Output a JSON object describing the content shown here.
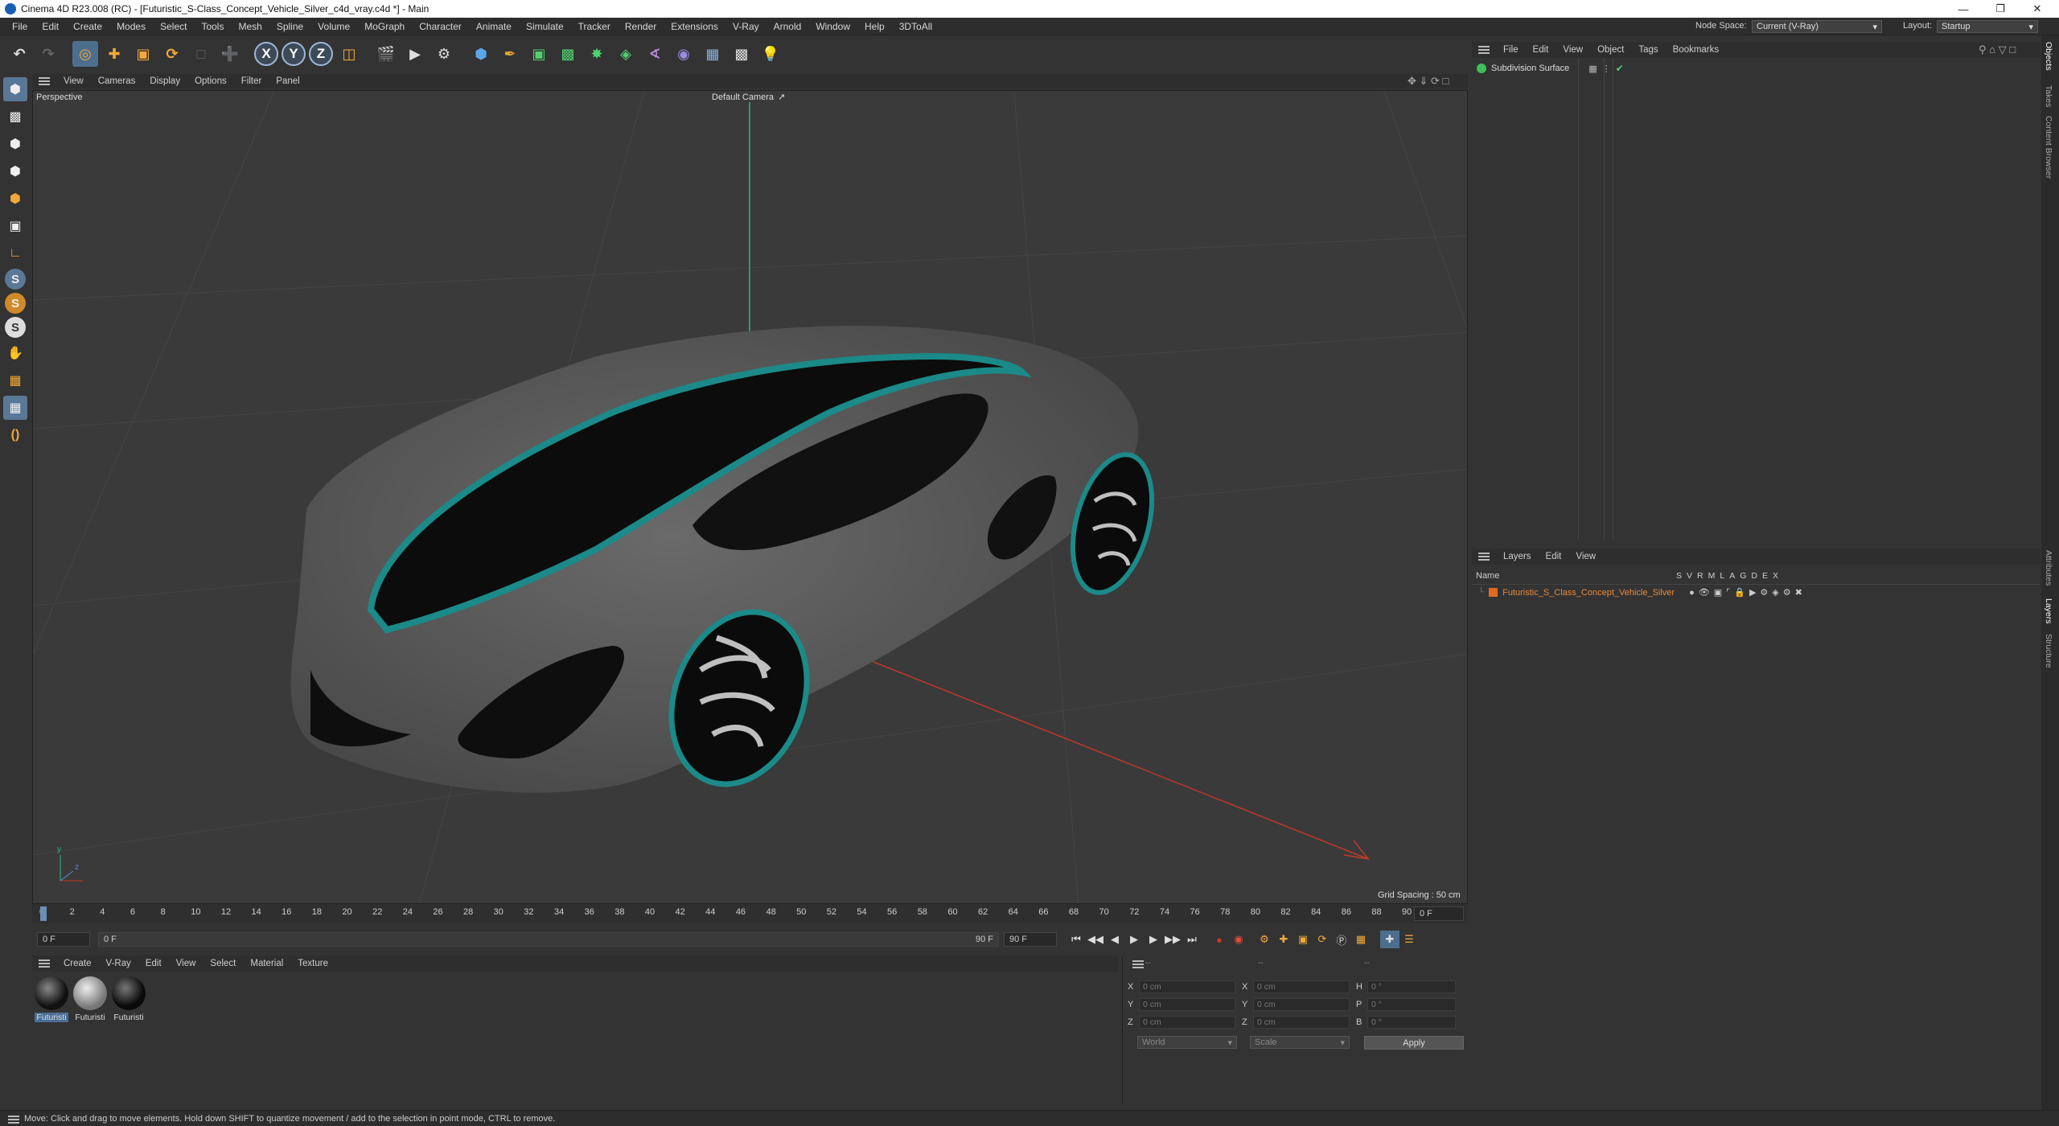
{
  "window": {
    "title": "Cinema 4D R23.008 (RC) - [Futuristic_S-Class_Concept_Vehicle_Silver_c4d_vray.c4d *] - Main"
  },
  "menu": [
    "File",
    "Edit",
    "Create",
    "Modes",
    "Select",
    "Tools",
    "Mesh",
    "Spline",
    "Volume",
    "MoGraph",
    "Character",
    "Animate",
    "Simulate",
    "Tracker",
    "Render",
    "Extensions",
    "V-Ray",
    "Arnold",
    "Window",
    "Help",
    "3DToAll"
  ],
  "header_right": {
    "node_space_label": "Node Space:",
    "node_space_value": "Current (V-Ray)",
    "layout_label": "Layout:",
    "layout_value": "Startup"
  },
  "toolbar": {
    "axes": [
      "X",
      "Y",
      "Z"
    ]
  },
  "viewport": {
    "menu": [
      "View",
      "Cameras",
      "Display",
      "Options",
      "Filter",
      "Panel"
    ],
    "name": "Perspective",
    "camera": "Default Camera",
    "grid_spacing": "Grid Spacing : 50 cm",
    "colors": {
      "body": "#5b5b5b",
      "glass": "#0c0c0c",
      "accent": "#1b8a88"
    }
  },
  "timeline": {
    "ticks": [
      "0",
      "2",
      "4",
      "6",
      "8",
      "10",
      "12",
      "14",
      "16",
      "18",
      "20",
      "22",
      "24",
      "26",
      "28",
      "30",
      "32",
      "34",
      "36",
      "38",
      "40",
      "42",
      "44",
      "46",
      "48",
      "50",
      "52",
      "54",
      "56",
      "58",
      "60",
      "62",
      "64",
      "66",
      "68",
      "70",
      "72",
      "74",
      "76",
      "78",
      "80",
      "82",
      "84",
      "86",
      "88",
      "90"
    ],
    "current_frame": "0 F"
  },
  "transport": {
    "start": "0 F",
    "preview_start": "0 F",
    "preview_end": "90 F",
    "end": "90 F"
  },
  "materials": {
    "menu": [
      "Create",
      "V-Ray",
      "Edit",
      "View",
      "Select",
      "Material",
      "Texture"
    ],
    "items": [
      {
        "label": "Futuristi"
      },
      {
        "label": "Futuristi"
      },
      {
        "label": "Futuristi"
      }
    ]
  },
  "coords": {
    "header": [
      "--",
      "--",
      "--"
    ],
    "rows": [
      {
        "a": "X",
        "av": "0 cm",
        "b": "X",
        "bv": "0 cm",
        "c": "H",
        "cv": "0 °"
      },
      {
        "a": "Y",
        "av": "0 cm",
        "b": "Y",
        "bv": "0 cm",
        "c": "P",
        "cv": "0 °"
      },
      {
        "a": "Z",
        "av": "0 cm",
        "b": "Z",
        "bv": "0 cm",
        "c": "B",
        "cv": "0 °"
      }
    ],
    "space": "World",
    "mode": "Scale",
    "apply": "Apply"
  },
  "objects": {
    "menu": [
      "File",
      "Edit",
      "View",
      "Object",
      "Tags",
      "Bookmarks"
    ],
    "items": [
      {
        "name": "Subdivision Surface"
      }
    ]
  },
  "layers": {
    "menu": [
      "Layers",
      "Edit",
      "View"
    ],
    "name_header": "Name",
    "flags": [
      "S",
      "V",
      "R",
      "M",
      "L",
      "A",
      "G",
      "D",
      "E",
      "X"
    ],
    "items": [
      {
        "name": "Futuristic_S_Class_Concept_Vehicle_Silver",
        "color": "#e06a22"
      }
    ]
  },
  "side_tabs": [
    "Objects",
    "Takes",
    "Content Browser",
    "Attributes",
    "Layers",
    "Structure"
  ],
  "status": "Move: Click and drag to move elements. Hold down SHIFT to quantize movement / add to the selection in point mode, CTRL to remove."
}
